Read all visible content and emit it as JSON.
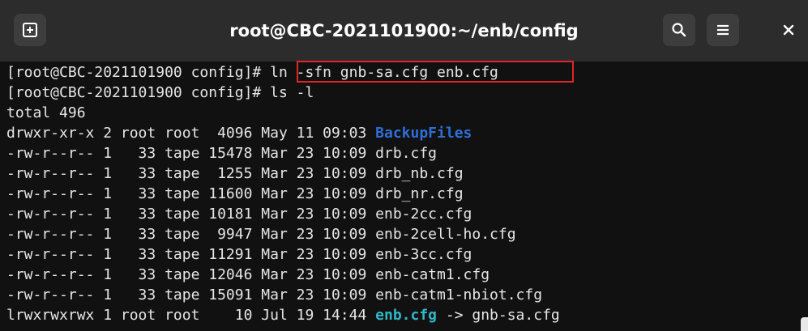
{
  "window": {
    "title": "root@CBC-2021101900:~/enb/config",
    "new_tab_icon": "new-tab-icon",
    "search_icon": "search-icon",
    "menu_icon": "hamburger-menu-icon",
    "close_icon": "close-icon"
  },
  "colors": {
    "directory": "#2f6fd6",
    "symlink": "#31b8c6",
    "highlight_box": "#e0262a",
    "terminal_bg": "#111111",
    "titlebar_bg": "#2c2c2c"
  },
  "terminal": {
    "lines": [
      {
        "prompt": "[root@CBC-2021101900 config]# ",
        "command": "ln -sfn gnb-sa.cfg enb.cfg"
      },
      {
        "prompt": "[root@CBC-2021101900 config]# ",
        "command": "ls -l"
      },
      {
        "text": "total 496"
      },
      {
        "meta": "drwxr-xr-x 2 root root  4096 May 11 09:03 ",
        "name": "BackupFiles"
      },
      {
        "meta": "-rw-r--r-- 1   33 tape 15478 Mar 23 10:09 ",
        "name": "drb.cfg"
      },
      {
        "meta": "-rw-r--r-- 1   33 tape  1255 Mar 23 10:09 ",
        "name": "drb_nb.cfg"
      },
      {
        "meta": "-rw-r--r-- 1   33 tape 11600 Mar 23 10:09 ",
        "name": "drb_nr.cfg"
      },
      {
        "meta": "-rw-r--r-- 1   33 tape 10181 Mar 23 10:09 ",
        "name": "enb-2cc.cfg"
      },
      {
        "meta": "-rw-r--r-- 1   33 tape  9947 Mar 23 10:09 ",
        "name": "enb-2cell-ho.cfg"
      },
      {
        "meta": "-rw-r--r-- 1   33 tape 11291 Mar 23 10:09 ",
        "name": "enb-3cc.cfg"
      },
      {
        "meta": "-rw-r--r-- 1   33 tape 12046 Mar 23 10:09 ",
        "name": "enb-catm1.cfg"
      },
      {
        "meta": "-rw-r--r-- 1   33 tape 15091 Mar 23 10:09 ",
        "name": "enb-catm1-nbiot.cfg"
      },
      {
        "meta": "lrwxrwxrwx 1 root root    10 Jul 19 14:44 ",
        "name": "enb.cfg",
        "arrow": " -> ",
        "target": "gnb-sa.cfg"
      }
    ]
  }
}
